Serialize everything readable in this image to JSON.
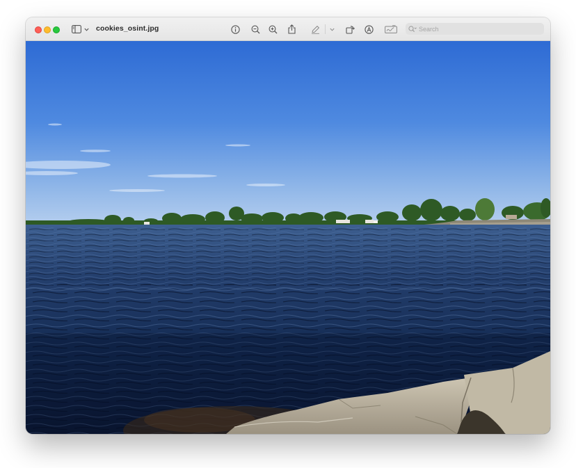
{
  "window": {
    "title": "cookies_osint.jpg"
  },
  "toolbar": {
    "icons": [
      "sidebar-icon",
      "chevron-down-icon",
      "info-icon",
      "zoom-out-icon",
      "zoom-in-icon",
      "share-icon",
      "markup-pen-icon",
      "chevron-down-icon",
      "rotate-icon",
      "annotate-icon",
      "sign-icon"
    ],
    "search": {
      "placeholder": "Search",
      "value": ""
    }
  },
  "image": {
    "subject": "lake-shoreline-photo",
    "colors": {
      "sky_top": "#2f6fd6",
      "sky_bottom": "#a9c8ea",
      "water_near": "#0c1e3f",
      "water_far": "#3a5c8d",
      "rock": "#b6ad9a",
      "trees": "#2f5b24"
    }
  }
}
